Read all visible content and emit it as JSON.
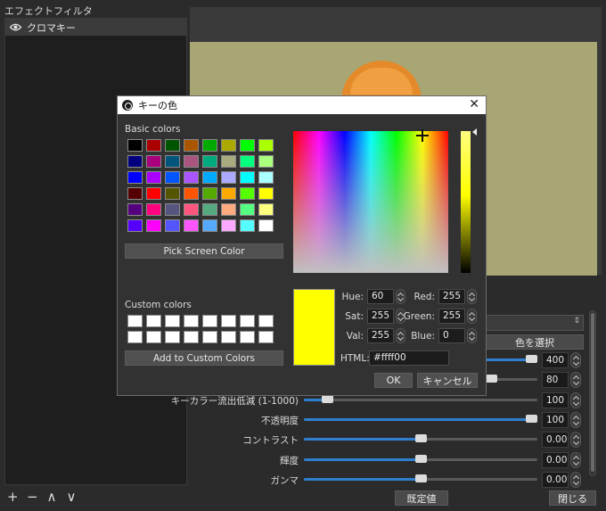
{
  "left_panel": {
    "title": "エフェクトフィルタ",
    "filters": [
      {
        "name": "クロマキー",
        "visible": true
      }
    ]
  },
  "bottom_toolbar": {
    "add": "+",
    "remove": "−",
    "up": "∧",
    "down": "∨"
  },
  "properties": {
    "select_color_label": "色を選択",
    "rows": [
      {
        "label": "",
        "value": "400",
        "fraction": 1.0
      },
      {
        "label": "",
        "value": "80",
        "fraction": 0.8
      },
      {
        "label": "キーカラー流出低減 (1-1000)",
        "value": "100",
        "fraction": 0.1
      },
      {
        "label": "不透明度",
        "value": "100",
        "fraction": 1.0
      },
      {
        "label": "コントラスト",
        "value": "0.00",
        "fraction": 0.5
      },
      {
        "label": "輝度",
        "value": "0.00",
        "fraction": 0.5
      },
      {
        "label": "ガンマ",
        "value": "0.00",
        "fraction": 0.5
      }
    ],
    "default_button": "既定値",
    "close_button": "閉じる"
  },
  "dialog": {
    "title": "キーの色",
    "basic_colors_label": "Basic colors",
    "basic_colors": [
      "#000000",
      "#aa0000",
      "#005500",
      "#aa5500",
      "#00aa00",
      "#aaaa00",
      "#00ff00",
      "#aaff00",
      "#00007f",
      "#aa007f",
      "#00557f",
      "#aa557f",
      "#00aa7f",
      "#aaaa7f",
      "#00ff7f",
      "#aaff7f",
      "#0000ff",
      "#aa00ff",
      "#0055ff",
      "#aa55ff",
      "#00aaff",
      "#aaaaff",
      "#00ffff",
      "#aaffff",
      "#550000",
      "#ff0000",
      "#555500",
      "#ff5500",
      "#55aa00",
      "#ffaa00",
      "#55ff00",
      "#ffff00",
      "#55007f",
      "#ff007f",
      "#55557f",
      "#ff557f",
      "#55aa7f",
      "#ffaa7f",
      "#55ff7f",
      "#ffff7f",
      "#5500ff",
      "#ff00ff",
      "#5555ff",
      "#ff55ff",
      "#55aaff",
      "#ffaaff",
      "#55ffff",
      "#ffffff"
    ],
    "pick_screen_color": "Pick Screen Color",
    "custom_colors_label": "Custom colors",
    "custom_colors": [
      "#ffffff",
      "#ffffff",
      "#ffffff",
      "#ffffff",
      "#ffffff",
      "#ffffff",
      "#ffffff",
      "#ffffff",
      "#ffffff",
      "#ffffff",
      "#ffffff",
      "#ffffff",
      "#ffffff",
      "#ffffff",
      "#ffffff",
      "#ffffff"
    ],
    "add_custom_colors": "Add to Custom Colors",
    "current_color": "#ffff00",
    "fields": {
      "hue_label": "Hue:",
      "hue": "60",
      "sat_label": "Sat:",
      "sat": "255",
      "val_label": "Val:",
      "val": "255",
      "red_label": "Red:",
      "red": "255",
      "green_label": "Green:",
      "green": "255",
      "blue_label": "Blue:",
      "blue": "0"
    },
    "html_label": "HTML:",
    "html_value": "#ffff00",
    "ok": "OK",
    "cancel": "キャンセル"
  }
}
